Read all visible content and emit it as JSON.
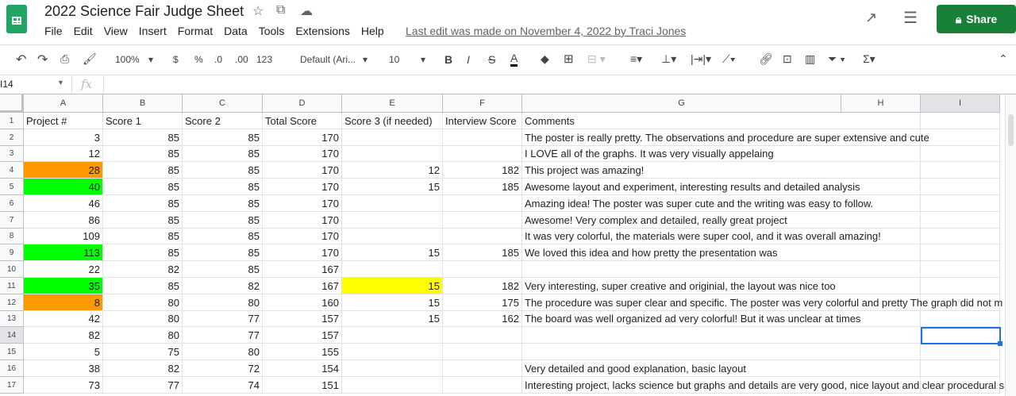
{
  "doc": {
    "title": "2022 Science Fair Judge Sheet",
    "last_edit": "Last edit was made on November 4, 2022 by Traci Jones",
    "share": "Share"
  },
  "menu": [
    "File",
    "Edit",
    "View",
    "Insert",
    "Format",
    "Data",
    "Tools",
    "Extensions",
    "Help"
  ],
  "toolbar": {
    "zoom": "100%",
    "currency": "$",
    "percent": "%",
    "dec_less": ".0",
    "dec_more": ".00",
    "format": "123",
    "font": "Default (Ari...",
    "size": "10",
    "bold": "B",
    "italic": "I",
    "strike": "S",
    "textcolor": "A"
  },
  "formula_bar": {
    "cell_ref": "I14",
    "fx": "fx",
    "value": ""
  },
  "columns": [
    "A",
    "B",
    "C",
    "D",
    "E",
    "F",
    "G",
    "H",
    "I"
  ],
  "colors": {
    "orange": "#ff9900",
    "green": "#00ff00",
    "yellow": "#ffff00",
    "share": "#188038"
  },
  "rows": [
    [
      "Project #",
      "Score 1",
      "Score 2",
      "Total Score",
      "Score 3 (if needed)",
      "Interview Score",
      "Comments",
      "",
      ""
    ],
    [
      "3",
      "85",
      "85",
      "170",
      "",
      "",
      "The poster is really pretty. The observations and procedure are super extensive and cute",
      "",
      ""
    ],
    [
      "12",
      "85",
      "85",
      "170",
      "",
      "",
      "I LOVE all of the graphs. It was very visually appelaing",
      "",
      ""
    ],
    [
      "28",
      "85",
      "85",
      "170",
      "12",
      "182",
      "This project was amazing!",
      "",
      ""
    ],
    [
      "40",
      "85",
      "85",
      "170",
      "15",
      "185",
      "Awesome layout and experiment, interesting results and detailed analysis",
      "",
      ""
    ],
    [
      "46",
      "85",
      "85",
      "170",
      "",
      "",
      "Amazing idea! The poster was super cute and the writing was easy to follow.",
      "",
      ""
    ],
    [
      "86",
      "85",
      "85",
      "170",
      "",
      "",
      "Awesome! Very complex and detailed, really great project",
      "",
      ""
    ],
    [
      "109",
      "85",
      "85",
      "170",
      "",
      "",
      "It was very colorful, the materials were super cool, and it was overall amazing!",
      "",
      ""
    ],
    [
      "113",
      "85",
      "85",
      "170",
      "15",
      "185",
      "We loved this idea and how pretty the presentation was",
      "",
      ""
    ],
    [
      "22",
      "82",
      "85",
      "167",
      "",
      "",
      "",
      "",
      ""
    ],
    [
      "35",
      "85",
      "82",
      "167",
      "15",
      "182",
      "Very interesting, super creative and originial, the layout was nice too",
      "",
      ""
    ],
    [
      "8",
      "80",
      "80",
      "160",
      "15",
      "175",
      "The procedure was super clear and specific. The poster was very colorful and pretty The graph did not m",
      "",
      ""
    ],
    [
      "42",
      "80",
      "77",
      "157",
      "15",
      "162",
      "The board was well organized ad very colorful! But it was unclear at times",
      "",
      ""
    ],
    [
      "82",
      "80",
      "77",
      "157",
      "",
      "",
      "",
      "",
      ""
    ],
    [
      "5",
      "75",
      "80",
      "155",
      "",
      "",
      "",
      "",
      ""
    ],
    [
      "38",
      "82",
      "72",
      "154",
      "",
      "",
      "Very detailed and good explanation, basic layout",
      "",
      ""
    ],
    [
      "73",
      "77",
      "74",
      "151",
      "",
      "",
      "Interesting project, lacks science but graphs and details are very good, nice layout and clear procedural s",
      "",
      ""
    ]
  ],
  "fills": {
    "3.0": "#ff9900",
    "4.0": "#00ff00",
    "8.0": "#00ff00",
    "10.0": "#00ff00",
    "11.0": "#ff9900",
    "10.4": "#ffff00"
  }
}
